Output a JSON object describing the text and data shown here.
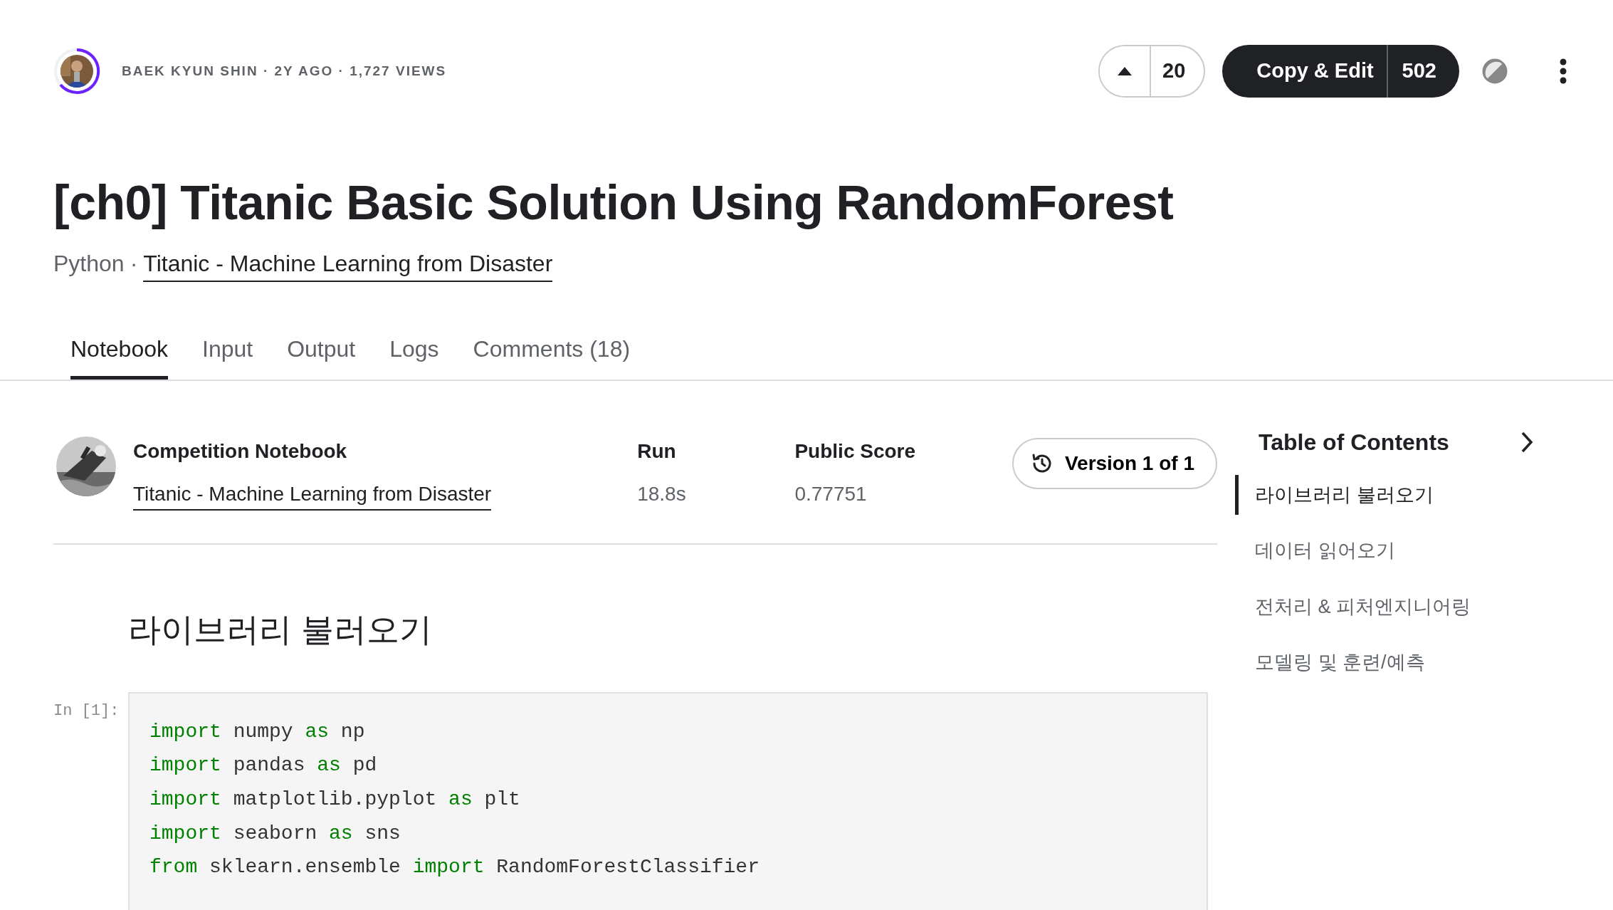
{
  "author": {
    "meta": "BAEK KYUN SHIN · 2Y AGO · 1,727 VIEWS"
  },
  "votes": {
    "count": "20"
  },
  "copy_edit": {
    "label": "Copy & Edit",
    "count": "502"
  },
  "title": "[ch0] Titanic Basic Solution Using RandomForest",
  "subtitle": {
    "language": "Python",
    "separator": "·",
    "link": "Titanic - Machine Learning from Disaster"
  },
  "tabs": [
    {
      "label": "Notebook",
      "selected": true
    },
    {
      "label": "Input",
      "selected": false
    },
    {
      "label": "Output",
      "selected": false
    },
    {
      "label": "Logs",
      "selected": false
    },
    {
      "label": "Comments (18)",
      "selected": false
    }
  ],
  "competition": {
    "heading": "Competition Notebook",
    "link": "Titanic - Machine Learning from Disaster",
    "run_label": "Run",
    "run_value": "18.8s",
    "score_label": "Public Score",
    "score_value": "0.77751",
    "version": "Version 1 of 1"
  },
  "section_heading": "라이브러리 불러오기",
  "cell": {
    "prompt": "In [1]:",
    "lines": [
      [
        {
          "kind": "keyword",
          "text": "import"
        },
        {
          "kind": "plain",
          "text": " numpy "
        },
        {
          "kind": "keyword",
          "text": "as"
        },
        {
          "kind": "plain",
          "text": " np"
        }
      ],
      [
        {
          "kind": "keyword",
          "text": "import"
        },
        {
          "kind": "plain",
          "text": " pandas "
        },
        {
          "kind": "keyword",
          "text": "as"
        },
        {
          "kind": "plain",
          "text": " pd"
        }
      ],
      [
        {
          "kind": "keyword",
          "text": "import"
        },
        {
          "kind": "plain",
          "text": " matplotlib.pyplot "
        },
        {
          "kind": "keyword",
          "text": "as"
        },
        {
          "kind": "plain",
          "text": " plt"
        }
      ],
      [
        {
          "kind": "keyword",
          "text": "import"
        },
        {
          "kind": "plain",
          "text": " seaborn "
        },
        {
          "kind": "keyword",
          "text": "as"
        },
        {
          "kind": "plain",
          "text": " sns"
        }
      ],
      [
        {
          "kind": "keyword",
          "text": "from"
        },
        {
          "kind": "plain",
          "text": " sklearn.ensemble "
        },
        {
          "kind": "keyword",
          "text": "import"
        },
        {
          "kind": "plain",
          "text": " RandomForestClassifier"
        }
      ]
    ]
  },
  "toc": {
    "title": "Table of Contents",
    "items": [
      {
        "label": "라이브러리 불러오기",
        "selected": true
      },
      {
        "label": "데이터 읽어오기",
        "selected": false
      },
      {
        "label": "전처리 & 피처엔지니어링",
        "selected": false
      },
      {
        "label": "모델링 및 훈련/예측",
        "selected": false
      }
    ]
  }
}
